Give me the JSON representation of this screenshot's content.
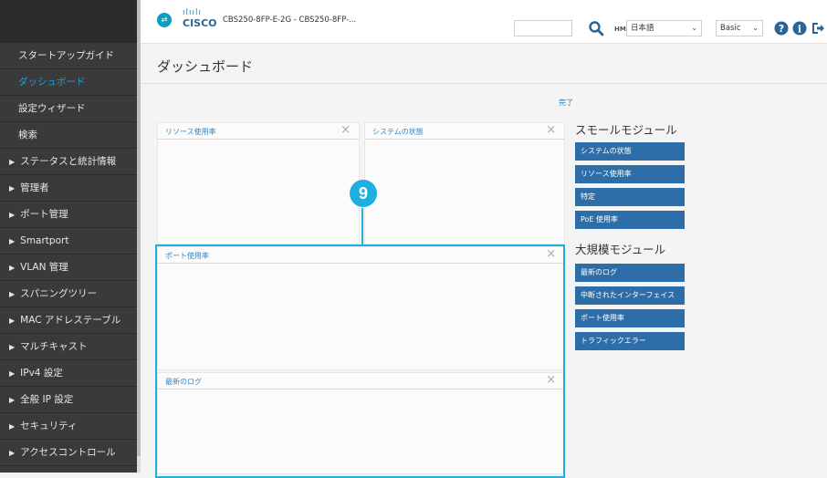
{
  "sidebar": {
    "items": [
      {
        "label": "スタートアップガイド",
        "arrow": ""
      },
      {
        "label": "ダッシュボード",
        "arrow": ""
      },
      {
        "label": "設定ウィザード",
        "arrow": ""
      },
      {
        "label": "検索",
        "arrow": ""
      },
      {
        "label": "ステータスと統計情報",
        "arrow": "▶"
      },
      {
        "label": "管理者",
        "arrow": "▶"
      },
      {
        "label": "ポート管理",
        "arrow": "▶"
      },
      {
        "label": "Smartport",
        "arrow": "▶"
      },
      {
        "label": "VLAN 管理",
        "arrow": "▶"
      },
      {
        "label": "スパニングツリー",
        "arrow": "▶"
      },
      {
        "label": "MAC アドレステーブル",
        "arrow": "▶"
      },
      {
        "label": "マルチキャスト",
        "arrow": "▶"
      },
      {
        "label": "IPv4 設定",
        "arrow": "▶"
      },
      {
        "label": "全般 IP 設定",
        "arrow": "▶"
      },
      {
        "label": "セキュリティ",
        "arrow": "▶"
      },
      {
        "label": "アクセスコントロール",
        "arrow": "▶"
      }
    ],
    "active_index": 1
  },
  "header": {
    "brand_icon": "⇄",
    "cisco_bars": "ılıılı",
    "cisco_word": "CISCO",
    "device_name": "CBS250-8FP-E-2G - CBS250-8FP-...",
    "search_placeholder": "",
    "hm_label": "HM",
    "language": "日本語",
    "mode": "Basic",
    "chevron": "⌄"
  },
  "page": {
    "title": "ダッシュボード",
    "done_link": "完了"
  },
  "panels": {
    "resource_usage": "リソース使用率",
    "system_status": "システムの状態",
    "port_usage": "ポート使用率",
    "recent_logs": "最新のログ",
    "close_glyph": "×"
  },
  "callout": {
    "number": "9",
    "color": "#21aee0"
  },
  "modules": {
    "small_title": "スモールモジュール",
    "small": [
      "システムの状態",
      "リソース使用率",
      "特定",
      "PoE 使用率"
    ],
    "large_title": "大規模モジュール",
    "large": [
      "最新のログ",
      "中断されたインターフェイス",
      "ポート使用率",
      "トラフィックエラー"
    ]
  },
  "colors": {
    "sidebar_bg": "#3a3a3a",
    "accent": "#21aee0",
    "module_button": "#2d6ea9",
    "active_item": "#1ba1d9"
  },
  "icons": [
    "brand-icon",
    "search-icon",
    "help-icon",
    "info-icon",
    "logout-icon"
  ]
}
